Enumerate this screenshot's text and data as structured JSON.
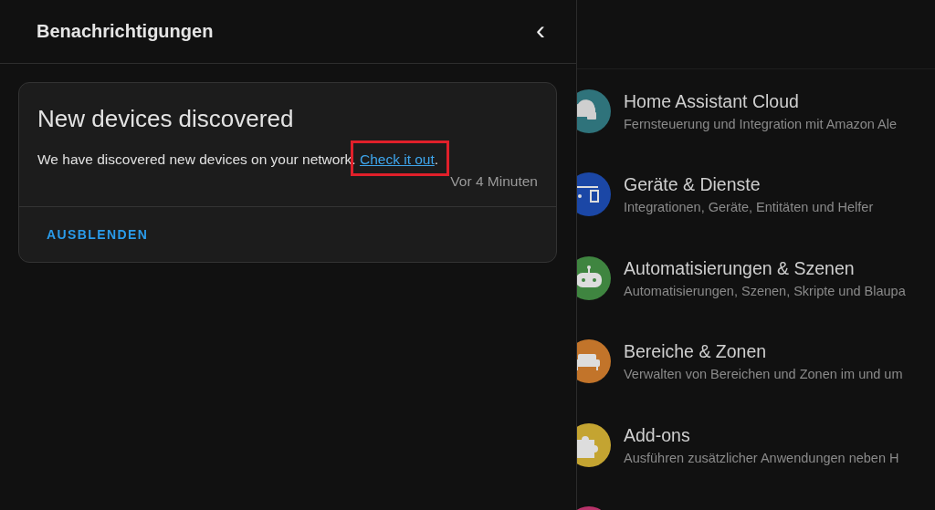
{
  "drawer": {
    "title": "Benachrichtigungen",
    "close_icon": "‹"
  },
  "notification": {
    "title": "New devices discovered",
    "message": "We have discovered new devices on your network.",
    "link": "Check it out",
    "link_highlighted": true,
    "after_link": ".",
    "time": "Vor 4 Minuten",
    "action": "AUSBLENDEN"
  },
  "settings": [
    {
      "kind": "cloud",
      "title": "Home Assistant Cloud",
      "subtitle": "Fernsteuerung und Integration mit Amazon Ale",
      "color": "#2f737b"
    },
    {
      "kind": "devices",
      "title": "Geräte & Dienste",
      "subtitle": "Integrationen, Geräte, Entitäten und Helfer",
      "color": "#1b47a6"
    },
    {
      "kind": "robot",
      "title": "Automatisierungen & Szenen",
      "subtitle": "Automatisierungen, Szenen, Skripte und Blaupa",
      "color": "#3f8540"
    },
    {
      "kind": "sofa",
      "title": "Bereiche & Zonen",
      "subtitle": "Verwalten von Bereichen und Zonen im und um",
      "color": "#c2742a"
    },
    {
      "kind": "puzzle",
      "title": "Add-ons",
      "subtitle": "Ausführen zusätzlicher Anwendungen neben H",
      "color": "#c4a431"
    },
    {
      "kind": "partial",
      "color": "#b8336a"
    }
  ]
}
